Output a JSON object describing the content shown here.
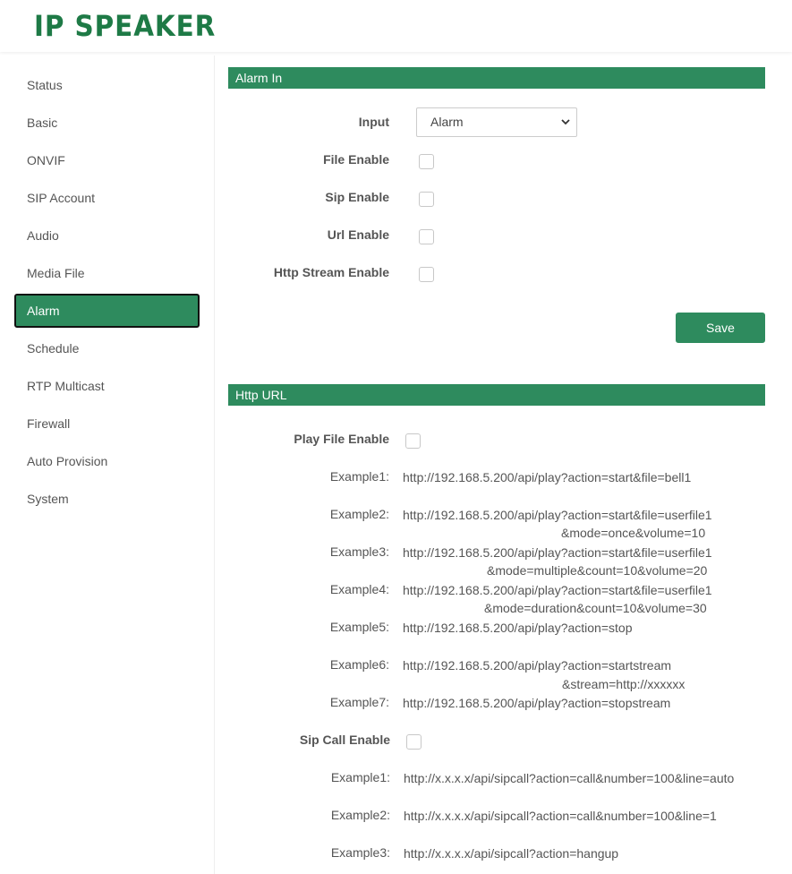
{
  "header": {
    "logo": "IP SPEAKER"
  },
  "sidebar": {
    "items": [
      {
        "label": "Status"
      },
      {
        "label": "Basic"
      },
      {
        "label": "ONVIF"
      },
      {
        "label": "SIP Account"
      },
      {
        "label": "Audio"
      },
      {
        "label": "Media File"
      },
      {
        "label": "Alarm"
      },
      {
        "label": "Schedule"
      },
      {
        "label": "RTP Multicast"
      },
      {
        "label": "Firewall"
      },
      {
        "label": "Auto Provision"
      },
      {
        "label": "System"
      }
    ],
    "active": "Alarm"
  },
  "alarm_in": {
    "title": "Alarm In",
    "input_label": "Input",
    "input_value": "Alarm",
    "file_enable_label": "File Enable",
    "sip_enable_label": "Sip Enable",
    "url_enable_label": "Url Enable",
    "http_stream_enable_label": "Http Stream Enable",
    "save_label": "Save"
  },
  "http_url": {
    "title": "Http URL",
    "play_file_enable_label": "Play File Enable",
    "play_examples": [
      {
        "label": "Example1:",
        "line1": "http://192.168.5.200/api/play?action=start&file=bell1",
        "line2": ""
      },
      {
        "label": "Example2:",
        "line1": "http://192.168.5.200/api/play?action=start&file=userfile1",
        "line2": "&mode=once&volume=10"
      },
      {
        "label": "Example3:",
        "line1": "http://192.168.5.200/api/play?action=start&file=userfile1",
        "line2": "&mode=multiple&count=10&volume=20"
      },
      {
        "label": "Example4:",
        "line1": "http://192.168.5.200/api/play?action=start&file=userfile1",
        "line2": "&mode=duration&count=10&volume=30"
      },
      {
        "label": "Example5:",
        "line1": "http://192.168.5.200/api/play?action=stop",
        "line2": ""
      },
      {
        "label": "Example6:",
        "line1": "http://192.168.5.200/api/play?action=startstream",
        "line2": "&stream=http://xxxxxx"
      },
      {
        "label": "Example7:",
        "line1": "http://192.168.5.200/api/play?action=stopstream",
        "line2": ""
      }
    ],
    "sip_call_enable_label": "Sip Call Enable",
    "sip_examples": [
      {
        "label": "Example1:",
        "url": "http://x.x.x.x/api/sipcall?action=call&number=100&line=auto"
      },
      {
        "label": "Example2:",
        "url": "http://x.x.x.x/api/sipcall?action=call&number=100&line=1"
      },
      {
        "label": "Example3:",
        "url": "http://x.x.x.x/api/sipcall?action=hangup"
      }
    ]
  },
  "colors": {
    "accent": "#2e8b5e",
    "logo": "#1e7a46"
  }
}
